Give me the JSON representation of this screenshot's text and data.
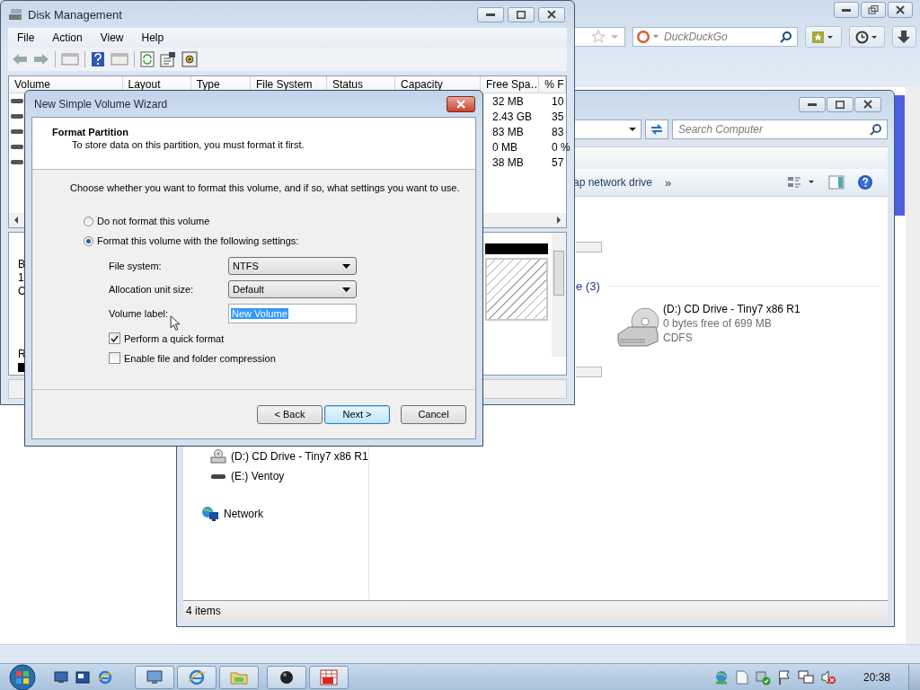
{
  "browser": {
    "search_placeholder": "DuckDuckGo"
  },
  "explorer": {
    "search_placeholder": "Search Computer",
    "toolbar": [
      "ap network drive",
      "»"
    ],
    "nav_items": [
      {
        "label": "(D:) CD Drive - Tiny7 x86 R1",
        "kind": "cd"
      },
      {
        "label": "(E:) Ventoy",
        "kind": "usb"
      },
      {
        "label": "Network",
        "kind": "network"
      }
    ],
    "group_heading": "e (3)",
    "drive": {
      "name": "(D:) CD Drive - Tiny7 x86 R1",
      "space": "0 bytes free of 699 MB",
      "file_system": "CDFS"
    },
    "status": "4 items"
  },
  "disk_management": {
    "title": "Disk Management",
    "menu": [
      "File",
      "Action",
      "View",
      "Help"
    ],
    "columns": [
      "Volume",
      "Layout",
      "Type",
      "File System",
      "Status",
      "Capacity",
      "Free Spa…",
      "% F"
    ],
    "rows": [
      {
        "free": "32 MB",
        "percent": "10"
      },
      {
        "free": "2.43 GB",
        "percent": "35"
      },
      {
        "free": "83 MB",
        "percent": "83"
      },
      {
        "free": "0 MB",
        "percent": "0 %"
      },
      {
        "free": "38 MB",
        "percent": "57"
      }
    ],
    "disk_labels": [
      "B",
      "1",
      "C"
    ],
    "disk_label_lower": "R"
  },
  "wizard": {
    "title": "New Simple Volume Wizard",
    "heading": "Format Partition",
    "subheading": "To store data on this partition, you must format it first.",
    "instruction": "Choose whether you want to format this volume, and if so, what settings you want to use.",
    "options": [
      {
        "label": "Do not format this volume",
        "selected": false
      },
      {
        "label": "Format this volume with the following settings:",
        "selected": true
      }
    ],
    "fields": [
      {
        "label": "File system:",
        "kind": "dropdown",
        "value": "NTFS"
      },
      {
        "label": "Allocation unit size:",
        "kind": "dropdown",
        "value": "Default"
      },
      {
        "label": "Volume label:",
        "kind": "text",
        "value": "New Volume",
        "highlighted": true
      }
    ],
    "checkboxes": [
      {
        "label": "Perform a quick format",
        "checked": true
      },
      {
        "label": "Enable file and folder compression",
        "checked": false
      }
    ],
    "buttons": [
      {
        "label": "< Back",
        "default": false
      },
      {
        "label": "Next >",
        "default": true
      },
      {
        "label": "Cancel",
        "default": false
      }
    ]
  },
  "taskbar": {
    "clock": "20:38"
  }
}
